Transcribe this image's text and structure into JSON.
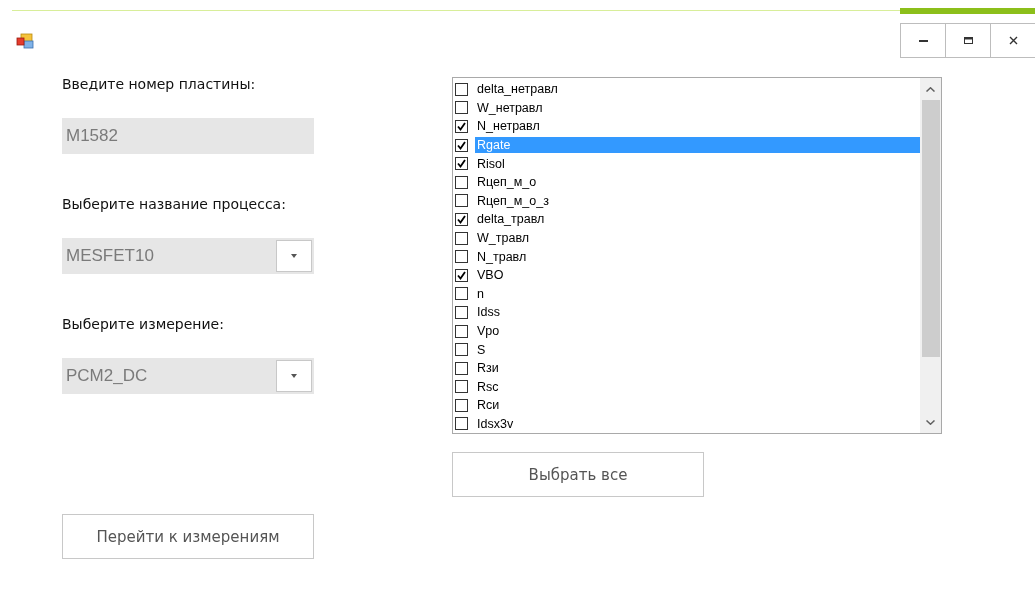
{
  "window": {
    "controls": [
      {
        "kind": "minimize"
      },
      {
        "kind": "maximize"
      },
      {
        "kind": "close"
      }
    ]
  },
  "plate": {
    "label": "Введите номер пластины:",
    "value": "M1582",
    "disabled": true
  },
  "process": {
    "label": "Выберите название процесса:",
    "value": "MESFET10",
    "disabled": true
  },
  "measurement": {
    "label": "Выберите измерение:",
    "value": "PCM2_DC",
    "disabled": true
  },
  "go_button": "Перейти к измерениям",
  "select_all_button": "Выбрать все",
  "parameters": [
    {
      "label": "delta_нетравл",
      "checked": false,
      "selected": false
    },
    {
      "label": "W_нетравл",
      "checked": false,
      "selected": false
    },
    {
      "label": "N_нетравл",
      "checked": true,
      "selected": false
    },
    {
      "label": "Rgate",
      "checked": true,
      "selected": true
    },
    {
      "label": "Risol",
      "checked": true,
      "selected": false
    },
    {
      "label": "Rцеп_м_о",
      "checked": false,
      "selected": false
    },
    {
      "label": "Rцеп_м_о_з",
      "checked": false,
      "selected": false
    },
    {
      "label": "delta_травл",
      "checked": true,
      "selected": false
    },
    {
      "label": "W_травл",
      "checked": false,
      "selected": false
    },
    {
      "label": "N_травл",
      "checked": false,
      "selected": false
    },
    {
      "label": "VBO",
      "checked": true,
      "selected": false
    },
    {
      "label": "n",
      "checked": false,
      "selected": false
    },
    {
      "label": "Idss",
      "checked": false,
      "selected": false
    },
    {
      "label": "Vpo",
      "checked": false,
      "selected": false
    },
    {
      "label": "S",
      "checked": false,
      "selected": false
    },
    {
      "label": "Rзи",
      "checked": false,
      "selected": false
    },
    {
      "label": "Rsc",
      "checked": false,
      "selected": false
    },
    {
      "label": "Rси",
      "checked": false,
      "selected": false
    },
    {
      "label": "Idsx3v",
      "checked": false,
      "selected": false
    }
  ]
}
